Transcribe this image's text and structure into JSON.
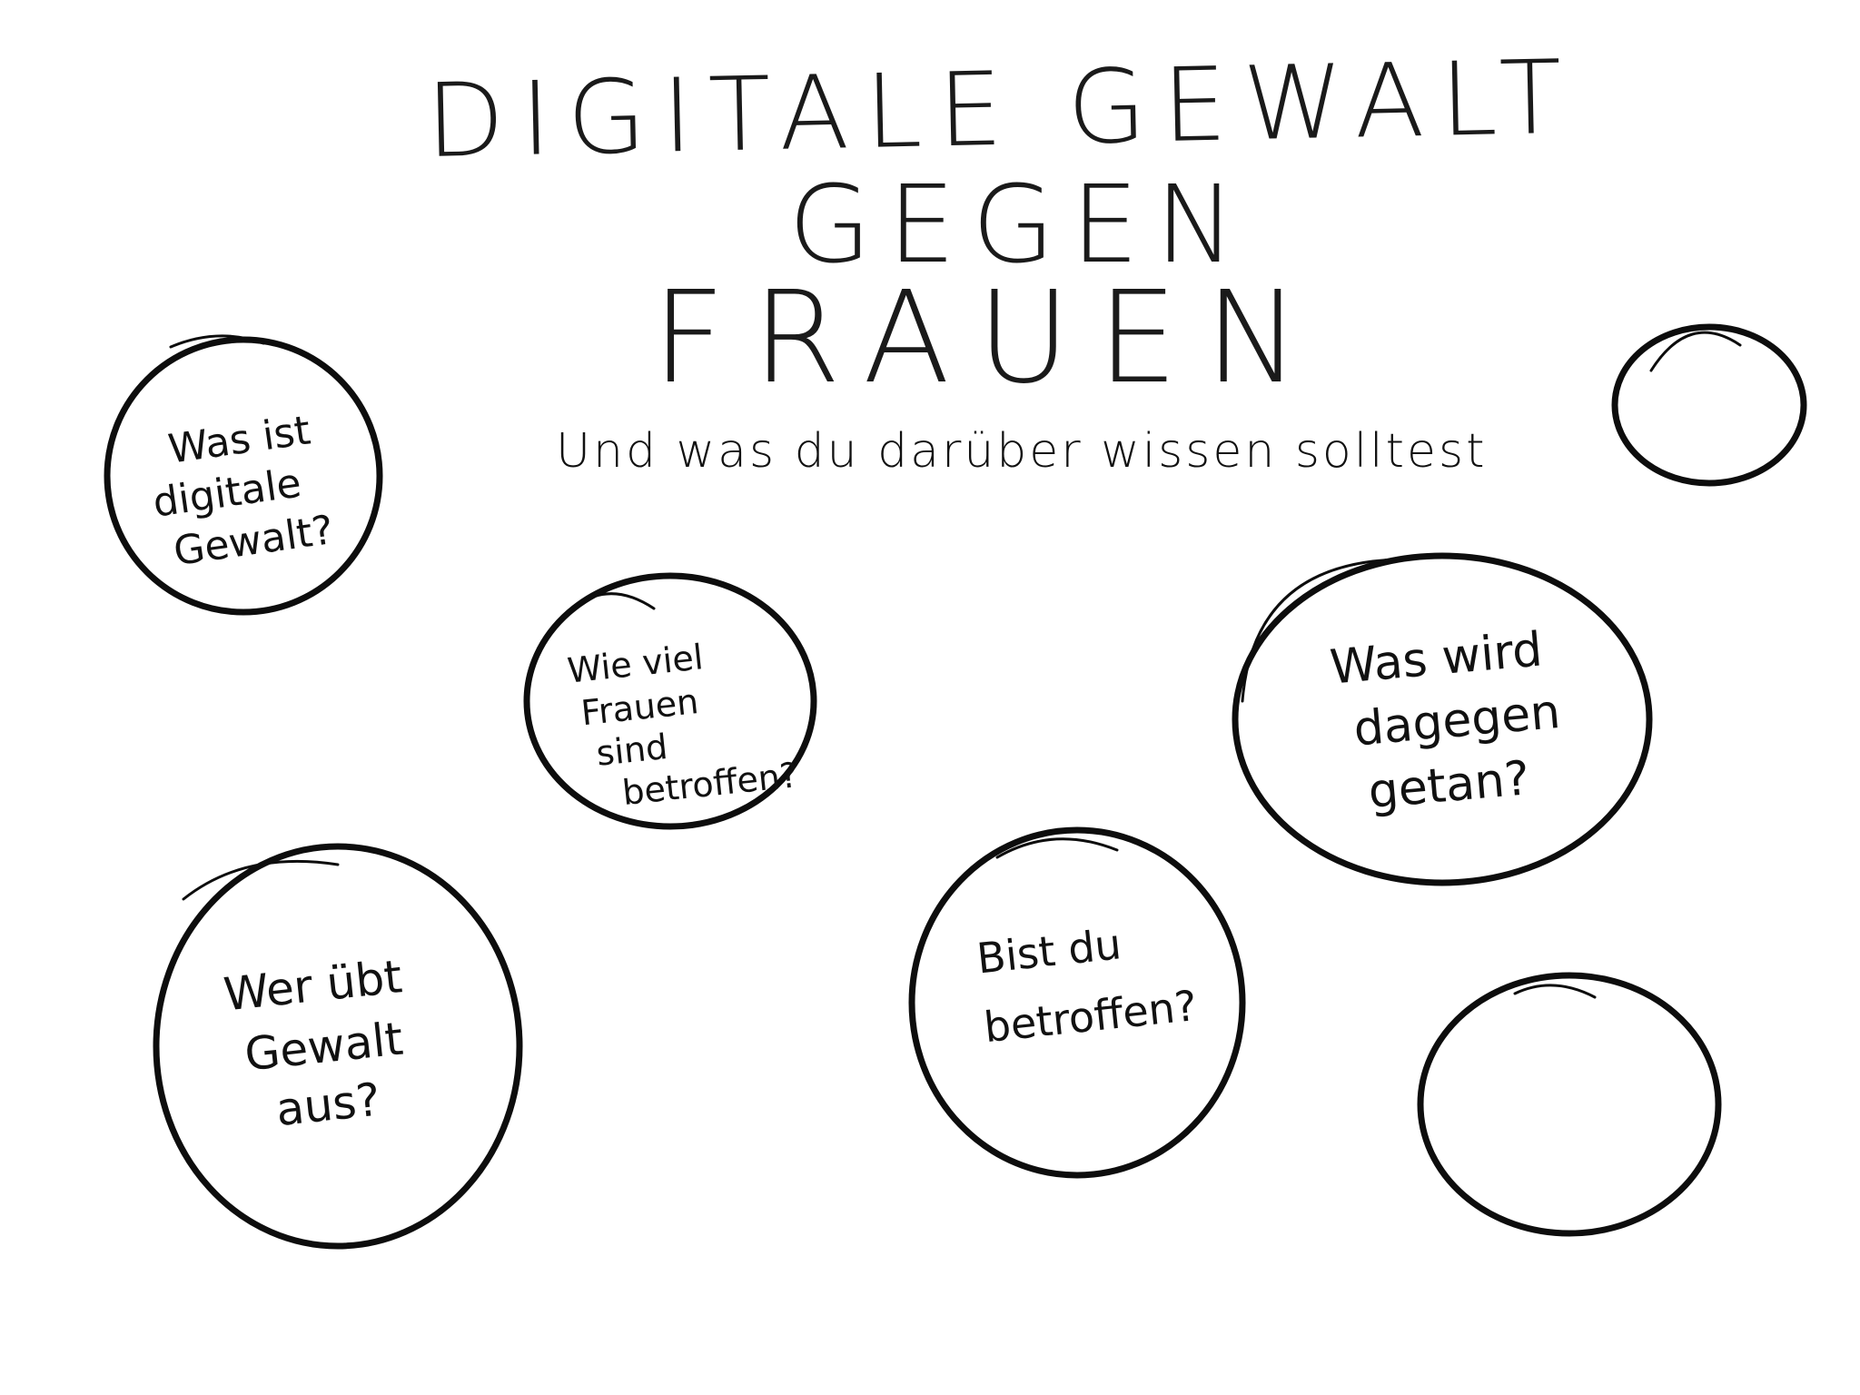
{
  "title": {
    "line1": "DIGITALE GEWALT",
    "line2": "GEGEN",
    "line3": "FRAUEN",
    "subtitle": "Und was du darüber wissen solltest"
  },
  "bubbles": [
    {
      "lines": [
        "Was ist",
        "digitale",
        "Gewalt?"
      ]
    },
    {
      "lines": [
        "Wie viel",
        "Frauen",
        "sind",
        "betroffen?"
      ]
    },
    {
      "lines": [
        "Was wird",
        "dagegen",
        "getan?"
      ]
    },
    {
      "lines": [
        "Wer übt",
        "Gewalt",
        "aus?"
      ]
    },
    {
      "lines": [
        "Bist du",
        "betroffen?"
      ]
    },
    {
      "lines": []
    },
    {
      "lines": []
    }
  ],
  "colors": {
    "ink": "#0d0d0d",
    "background": "#ffffff"
  }
}
